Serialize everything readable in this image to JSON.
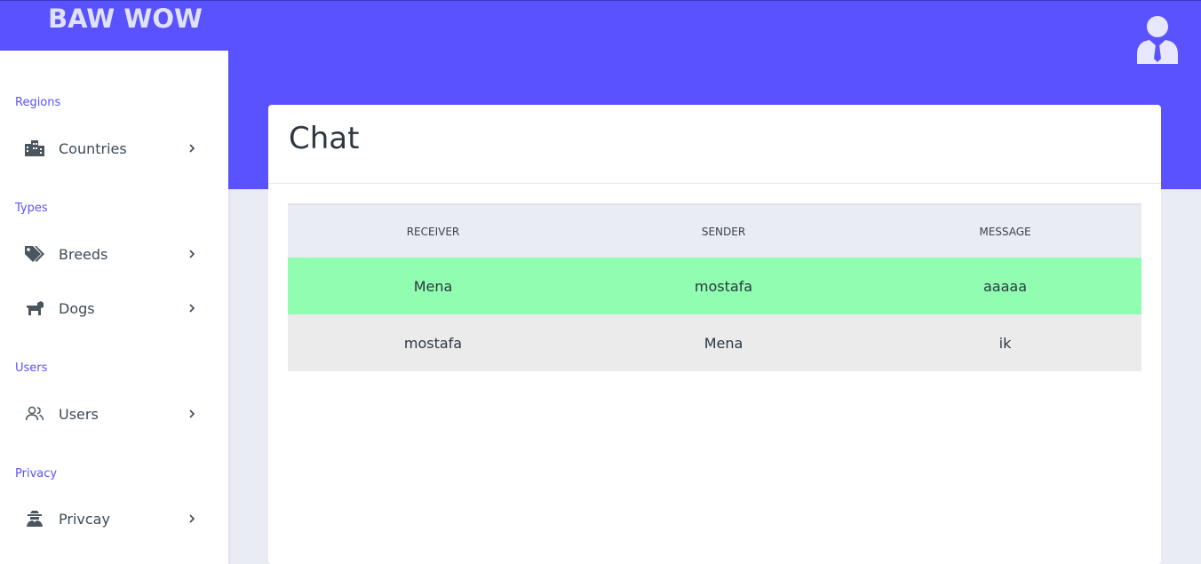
{
  "app": {
    "title": "BAW WOW"
  },
  "header": {
    "avatar_icon": "user-tie-icon"
  },
  "sidebar": {
    "sections": [
      {
        "label": "Regions",
        "items": [
          {
            "label": "Countries",
            "icon": "city-icon"
          }
        ]
      },
      {
        "label": "Types",
        "items": [
          {
            "label": "Breeds",
            "icon": "tags-icon"
          },
          {
            "label": "Dogs",
            "icon": "dog-icon"
          }
        ]
      },
      {
        "label": "Users",
        "items": [
          {
            "label": "Users",
            "icon": "users-icon"
          }
        ]
      },
      {
        "label": "Privacy",
        "items": [
          {
            "label": "Privcay",
            "icon": "user-secret-icon"
          }
        ]
      }
    ]
  },
  "main": {
    "title": "Chat",
    "table": {
      "columns": [
        "RECEIVER",
        "SENDER",
        "MESSAGE"
      ],
      "rows": [
        [
          "Mena",
          "mostafa",
          "aaaaa"
        ],
        [
          "mostafa",
          "Mena",
          "ik"
        ]
      ]
    }
  },
  "colors": {
    "brand": "#5a52ff",
    "highlight_row": "#90fdb0",
    "normal_row": "#ebebeb"
  }
}
